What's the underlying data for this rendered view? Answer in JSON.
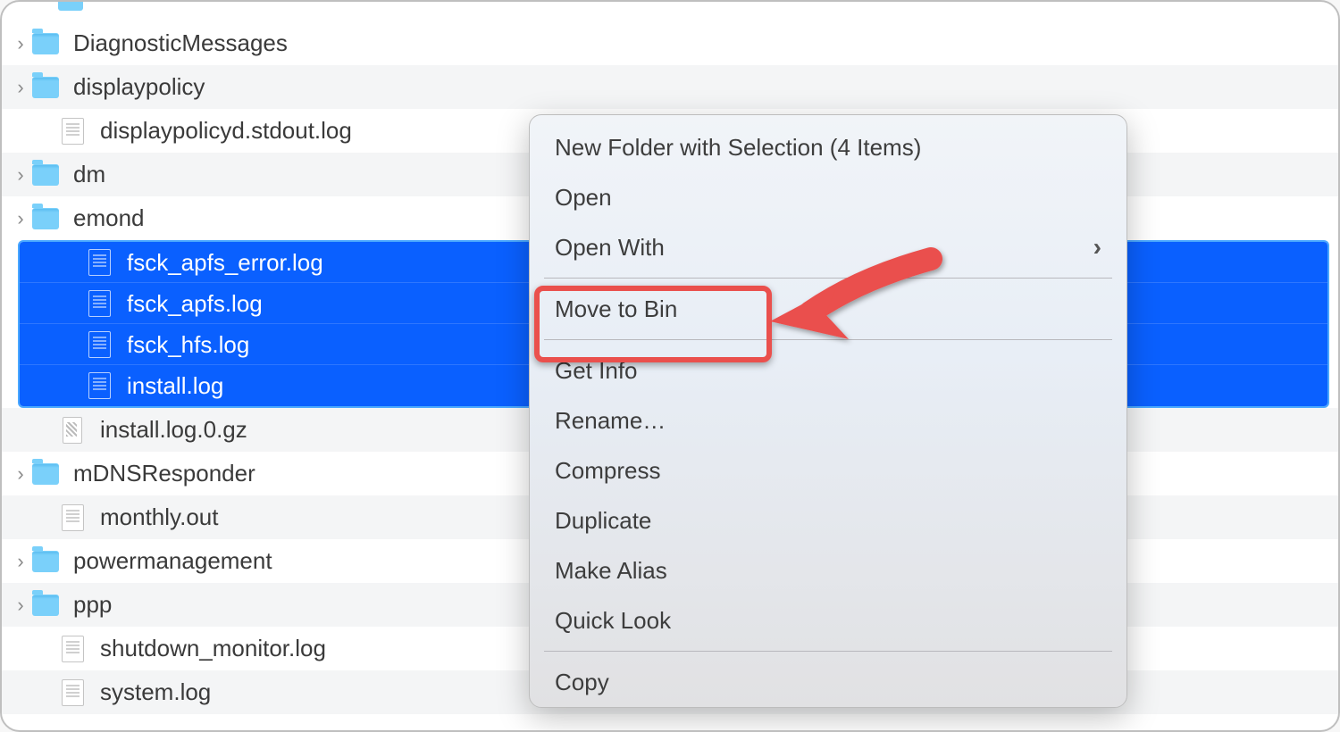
{
  "list": {
    "rows": [
      {
        "kind": "partial"
      },
      {
        "kind": "folder",
        "name": "DiagnosticMessages",
        "expandable": true
      },
      {
        "kind": "folder",
        "name": "displaypolicy",
        "expandable": true
      },
      {
        "kind": "file",
        "name": "displaypolicyd.stdout.log"
      },
      {
        "kind": "folder",
        "name": "dm",
        "expandable": true
      },
      {
        "kind": "folder",
        "name": "emond",
        "expandable": true
      }
    ],
    "selected": [
      {
        "kind": "file",
        "name": "fsck_apfs_error.log"
      },
      {
        "kind": "file",
        "name": "fsck_apfs.log"
      },
      {
        "kind": "file",
        "name": "fsck_hfs.log"
      },
      {
        "kind": "file",
        "name": "install.log"
      }
    ],
    "rows_after": [
      {
        "kind": "gz",
        "name": "install.log.0.gz"
      },
      {
        "kind": "folder",
        "name": "mDNSResponder",
        "expandable": true
      },
      {
        "kind": "file",
        "name": "monthly.out"
      },
      {
        "kind": "folder",
        "name": "powermanagement",
        "expandable": true
      },
      {
        "kind": "folder",
        "name": "ppp",
        "expandable": true
      },
      {
        "kind": "file",
        "name": "shutdown_monitor.log"
      },
      {
        "kind": "file",
        "name": "system.log"
      }
    ]
  },
  "context_menu": {
    "items": [
      {
        "label": "New Folder with Selection (4 Items)"
      },
      {
        "label": "Open"
      },
      {
        "label": "Open With",
        "submenu": true
      },
      {
        "sep": true
      },
      {
        "label": "Move to Bin",
        "highlight": true
      },
      {
        "sep": true
      },
      {
        "label": "Get Info"
      },
      {
        "label": "Rename…"
      },
      {
        "label": "Compress"
      },
      {
        "label": "Duplicate"
      },
      {
        "label": "Make Alias"
      },
      {
        "label": "Quick Look"
      },
      {
        "sep": true
      },
      {
        "label": "Copy"
      }
    ]
  },
  "annotation": {
    "highlight_target": "Move to Bin"
  }
}
